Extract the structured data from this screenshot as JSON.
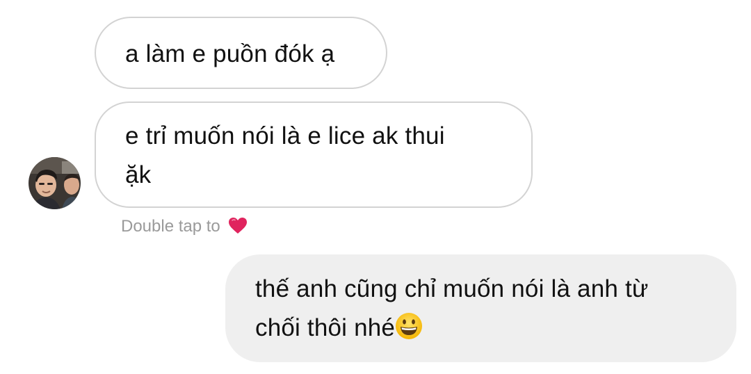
{
  "conversation": {
    "incoming": [
      {
        "lines": [
          "a làm e puồn đók ạ"
        ]
      },
      {
        "lines": [
          "e trỉ muốn nói là e lice ak thui",
          "ặk"
        ]
      }
    ],
    "reaction_hint": "Double tap to",
    "reaction_hint_icon": "red-heart-icon",
    "outgoing": [
      {
        "lines": [
          "thế anh cũng chỉ muốn nói là anh từ",
          "chối thôi nhé"
        ],
        "trailing_emoji": "grinning-face-icon"
      }
    ]
  },
  "colors": {
    "incoming_bubble_border": "#d3d3d3",
    "outgoing_bubble_bg": "#efefef",
    "hint_text": "#9a9a9a",
    "heart": "#e0245e"
  }
}
